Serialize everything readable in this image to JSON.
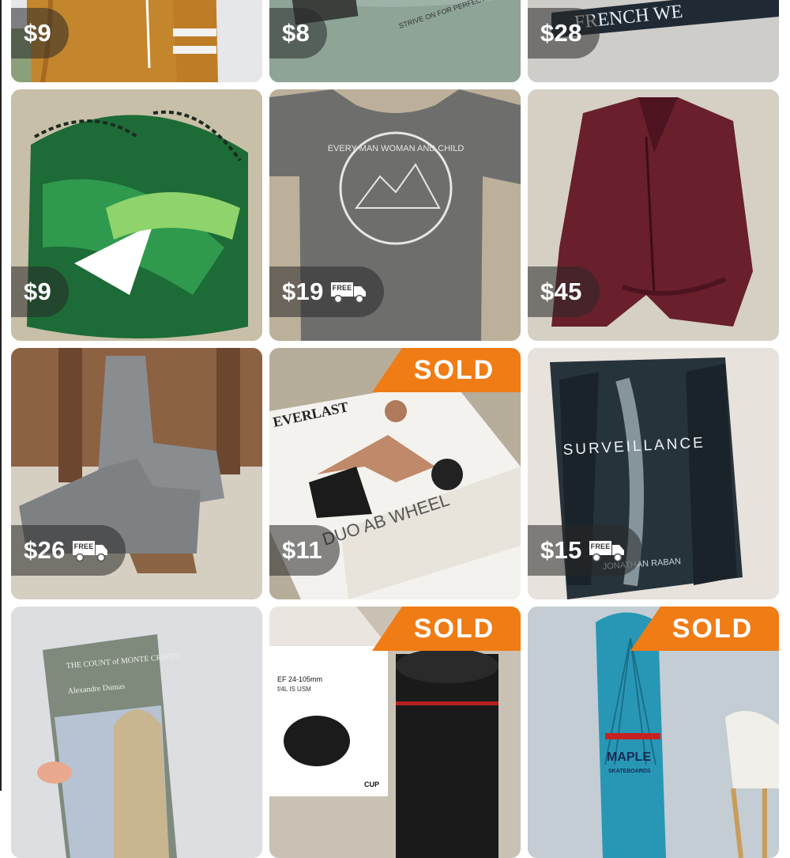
{
  "listings": [
    {
      "price": "$9",
      "free_shipping": false,
      "sold": false,
      "image": "orange-striped-jacket"
    },
    {
      "price": "$8",
      "free_shipping": false,
      "sold": false,
      "image": "sage-graphic-tee",
      "print_text": "STRIVE ON FOR PERFECTION"
    },
    {
      "price": "$28",
      "free_shipping": false,
      "sold": false,
      "image": "grey-french-tee",
      "print_text": "FRENCH WE"
    },
    {
      "price": "$9",
      "free_shipping": false,
      "sold": false,
      "image": "palm-leaf-swim-top"
    },
    {
      "price": "$19",
      "free_shipping": true,
      "sold": false,
      "image": "grey-tee-everyman",
      "print_text": "EVERY MAN WOMAN AND CHILD"
    },
    {
      "price": "$45",
      "free_shipping": false,
      "sold": false,
      "image": "burgundy-suede-bomber"
    },
    {
      "price": "$26",
      "free_shipping": true,
      "sold": false,
      "image": "grey-ankle-booties"
    },
    {
      "price": "$11",
      "free_shipping": false,
      "sold": true,
      "image": "everlast-ab-wheel",
      "print_text": "DUO AB WHEEL",
      "brand_text": "EVERLAST"
    },
    {
      "price": "$15",
      "free_shipping": true,
      "sold": false,
      "image": "surveillance-book",
      "title_text": "SURVEILLANCE",
      "author_text": "JONATHAN RABAN"
    },
    {
      "price": "",
      "free_shipping": false,
      "sold": false,
      "image": "count-of-monte-cristo-book",
      "title_text": "THE COUNT of MONTE CRISTO",
      "author_text": "Alexandre Dumas"
    },
    {
      "price": "",
      "free_shipping": false,
      "sold": true,
      "image": "lens-mug",
      "print_text": "EF 24-105mm",
      "sub_text": "f/4L IS USM",
      "cup_text": "CUP"
    },
    {
      "price": "",
      "free_shipping": false,
      "sold": true,
      "image": "maple-skateboard",
      "print_text": "MAPLE",
      "sub_text": "SKATEBOARDS"
    }
  ],
  "labels": {
    "free": "FREE",
    "sold": "SOLD"
  },
  "colors": {
    "sold_banner": "#f07c15",
    "price_pill": "rgba(40,40,40,0.55)"
  }
}
